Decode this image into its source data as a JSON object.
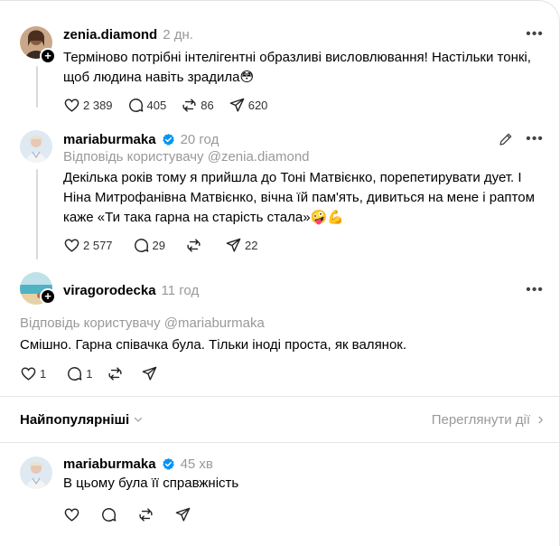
{
  "posts": [
    {
      "username": "zenia.diamond",
      "time": "2 дн.",
      "verified": false,
      "reply_to": "",
      "text": "Терміново потрібні інтелігентні образливі висловлювання! Настільки тонкі, щоб людина навіть зрадила😳",
      "likes": "2 389",
      "comments": "405",
      "reposts": "86",
      "shares": "620"
    },
    {
      "username": "mariaburmaka",
      "time": "20 год",
      "verified": true,
      "reply_to": "Відповідь користувачу @zenia.diamond",
      "text": "Декілька років тому я прийшла до Тоні Матвієнко, порепетирувати дует. І Ніна Митрофанівна Матвієнко, вічна їй пам'ять, дивиться на мене і раптом каже «Ти така гарна на старість стала»🤪💪",
      "likes": "2 577",
      "comments": "29",
      "reposts": "",
      "shares": "22"
    },
    {
      "username": "viragorodecka",
      "time": "11 год",
      "verified": false,
      "reply_to": "Відповідь користувачу @mariaburmaka",
      "text": "Смішно. Гарна співачка була. Тільки іноді проста, як валянок.",
      "likes": "1",
      "comments": "1",
      "reposts": "",
      "shares": ""
    },
    {
      "username": "mariaburmaka",
      "time": "45 хв",
      "verified": true,
      "reply_to": "",
      "text": "В цьому була її справжність",
      "likes": "",
      "comments": "",
      "reposts": "",
      "shares": ""
    }
  ],
  "sort": {
    "label": "Найпопулярніші",
    "view_activity": "Переглянути дії"
  },
  "icons": {
    "heart": "heart-icon",
    "comment": "comment-icon",
    "repost": "repost-icon",
    "share": "share-icon",
    "more": "more-icon",
    "edit": "pencil-icon",
    "verified": "verified-badge-icon"
  },
  "colors": {
    "verified": "#0095f6",
    "muted": "#999999",
    "line": "#d9d9d9"
  }
}
